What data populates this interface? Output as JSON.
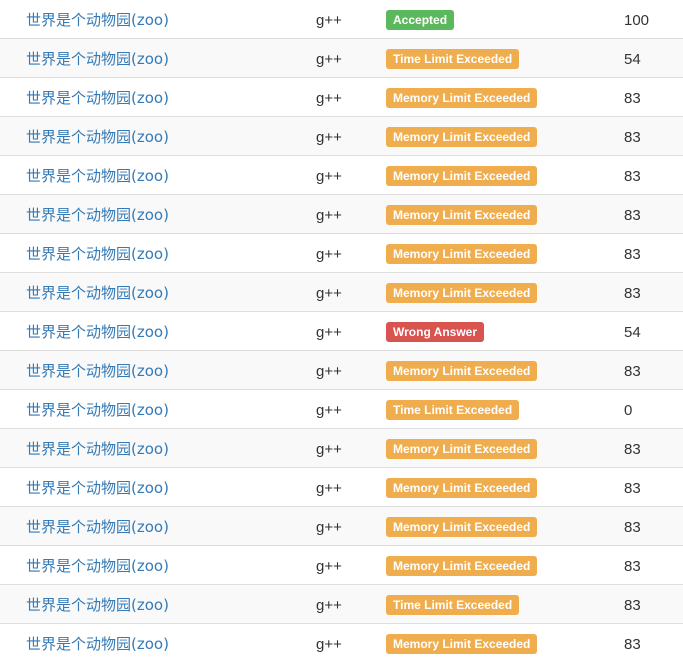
{
  "rows": [
    {
      "problem": "世界是个动物园(zoo)",
      "language": "g++",
      "status": "Accepted",
      "status_kind": "accepted",
      "score": "100"
    },
    {
      "problem": "世界是个动物园(zoo)",
      "language": "g++",
      "status": "Time Limit Exceeded",
      "status_kind": "tle",
      "score": "54"
    },
    {
      "problem": "世界是个动物园(zoo)",
      "language": "g++",
      "status": "Memory Limit Exceeded",
      "status_kind": "mle",
      "score": "83"
    },
    {
      "problem": "世界是个动物园(zoo)",
      "language": "g++",
      "status": "Memory Limit Exceeded",
      "status_kind": "mle",
      "score": "83"
    },
    {
      "problem": "世界是个动物园(zoo)",
      "language": "g++",
      "status": "Memory Limit Exceeded",
      "status_kind": "mle",
      "score": "83"
    },
    {
      "problem": "世界是个动物园(zoo)",
      "language": "g++",
      "status": "Memory Limit Exceeded",
      "status_kind": "mle",
      "score": "83"
    },
    {
      "problem": "世界是个动物园(zoo)",
      "language": "g++",
      "status": "Memory Limit Exceeded",
      "status_kind": "mle",
      "score": "83"
    },
    {
      "problem": "世界是个动物园(zoo)",
      "language": "g++",
      "status": "Memory Limit Exceeded",
      "status_kind": "mle",
      "score": "83"
    },
    {
      "problem": "世界是个动物园(zoo)",
      "language": "g++",
      "status": "Wrong Answer",
      "status_kind": "wa",
      "score": "54"
    },
    {
      "problem": "世界是个动物园(zoo)",
      "language": "g++",
      "status": "Memory Limit Exceeded",
      "status_kind": "mle",
      "score": "83"
    },
    {
      "problem": "世界是个动物园(zoo)",
      "language": "g++",
      "status": "Time Limit Exceeded",
      "status_kind": "tle",
      "score": "0"
    },
    {
      "problem": "世界是个动物园(zoo)",
      "language": "g++",
      "status": "Memory Limit Exceeded",
      "status_kind": "mle",
      "score": "83"
    },
    {
      "problem": "世界是个动物园(zoo)",
      "language": "g++",
      "status": "Memory Limit Exceeded",
      "status_kind": "mle",
      "score": "83"
    },
    {
      "problem": "世界是个动物园(zoo)",
      "language": "g++",
      "status": "Memory Limit Exceeded",
      "status_kind": "mle",
      "score": "83"
    },
    {
      "problem": "世界是个动物园(zoo)",
      "language": "g++",
      "status": "Memory Limit Exceeded",
      "status_kind": "mle",
      "score": "83"
    },
    {
      "problem": "世界是个动物园(zoo)",
      "language": "g++",
      "status": "Time Limit Exceeded",
      "status_kind": "tle",
      "score": "83"
    },
    {
      "problem": "世界是个动物园(zoo)",
      "language": "g++",
      "status": "Memory Limit Exceeded",
      "status_kind": "mle",
      "score": "83"
    }
  ],
  "colors": {
    "link": "#337ab7",
    "accepted": "#5cb85c",
    "warning": "#f0ad4e",
    "danger": "#d9534f",
    "stripe": "#f9f9f9",
    "border": "#dddddd"
  }
}
